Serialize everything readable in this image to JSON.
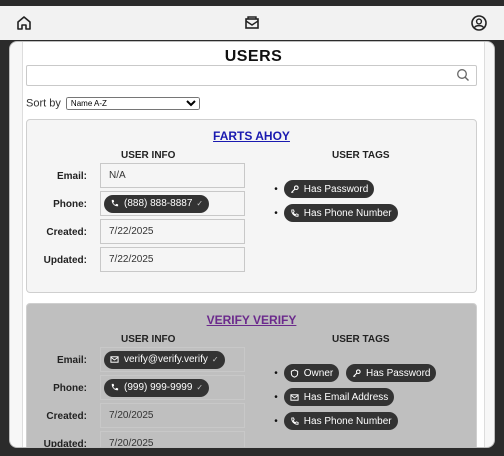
{
  "topbar": {
    "icons": [
      "home-icon",
      "mail-icon",
      "user-icon"
    ]
  },
  "page": {
    "title": "USERS",
    "search": {
      "value": "",
      "placeholder": ""
    },
    "sort": {
      "label": "Sort by",
      "selected": "Name A-Z"
    }
  },
  "users": [
    {
      "name": "FARTS AHOY",
      "info_header": "USER INFO",
      "tags_header": "USER TAGS",
      "labels": {
        "email": "Email:",
        "phone": "Phone:",
        "created": "Created:",
        "updated": "Updated:"
      },
      "email": "N/A",
      "phone": "(888) 888-8887",
      "created": "7/22/2025",
      "updated": "7/22/2025",
      "tags": [
        "Has Password",
        "Has Phone Number"
      ]
    },
    {
      "name": "VERIFY VERIFY",
      "info_header": "USER INFO",
      "tags_header": "USER TAGS",
      "labels": {
        "email": "Email:",
        "phone": "Phone:",
        "created": "Created:",
        "updated": "Updated:"
      },
      "email": "verify@verify.verify",
      "phone": "(999) 999-9999",
      "created": "7/20/2025",
      "updated": "7/20/2025",
      "tags": [
        "Owner",
        "Has Password",
        "Has Email Address",
        "Has Phone Number"
      ]
    }
  ],
  "colors": {
    "card1_bg": "#f5f5f5",
    "card2_bg": "#bfbfbf",
    "chip_bg": "#333333",
    "link": "#1a1ab0"
  }
}
